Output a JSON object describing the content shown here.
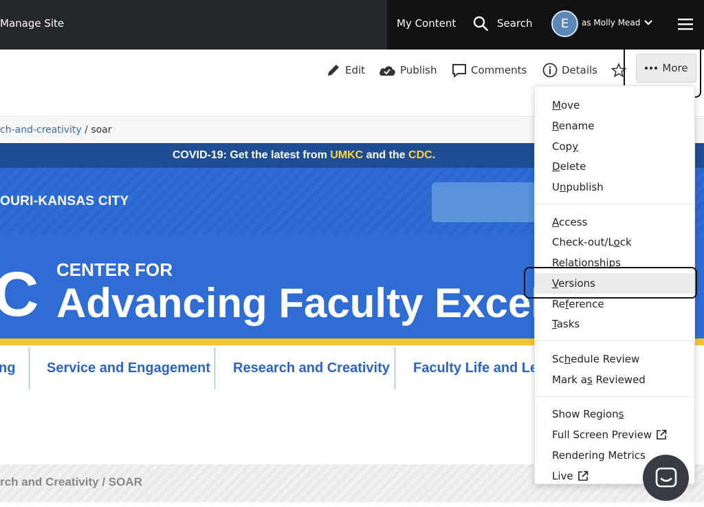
{
  "topbar": {
    "manage_site": "Manage Site",
    "my_content": "My Content",
    "search": "Search",
    "avatar_letter": "E",
    "as_user": "as Molly Mead"
  },
  "toolbar": {
    "edit": "Edit",
    "publish": "Publish",
    "comments": "Comments",
    "details": "Details",
    "more": "More"
  },
  "breadcrumb": {
    "parent": "ch-and-creativity",
    "separator": "/",
    "current": "soar"
  },
  "banner": {
    "prefix": "COVID-19: Get the latest from ",
    "umkc": "UMKC",
    "middle": " and the ",
    "cdc": "CDC",
    "suffix": "."
  },
  "hero": {
    "university": "OURI-KANSAS CITY",
    "logo_letter": "C",
    "center_for": "CENTER FOR",
    "title": "Advancing Faculty Excelle"
  },
  "nav": [
    "ng",
    "Service and Engagement",
    "Research and Creativity",
    "Faculty Life and Lea"
  ],
  "lower_breadcrumb": "rch and Creativity / SOAR",
  "menu": {
    "group1": [
      {
        "pre": "",
        "u": "M",
        "post": "ove"
      },
      {
        "pre": "",
        "u": "R",
        "post": "ename"
      },
      {
        "pre": "Cop",
        "u": "y",
        "post": ""
      },
      {
        "pre": "",
        "u": "D",
        "post": "elete"
      },
      {
        "pre": "U",
        "u": "n",
        "post": "publish"
      }
    ],
    "group2": [
      {
        "pre": "",
        "u": "A",
        "post": "ccess"
      },
      {
        "pre": "Check-out/L",
        "u": "o",
        "post": "ck"
      },
      {
        "pre": "Relat",
        "u": "i",
        "post": "onships"
      },
      {
        "pre": "",
        "u": "V",
        "post": "ersions"
      },
      {
        "pre": "Re",
        "u": "f",
        "post": "erence"
      },
      {
        "pre": "",
        "u": "T",
        "post": "asks"
      }
    ],
    "group3": [
      {
        "pre": "Sc",
        "u": "h",
        "post": "edule Review"
      },
      {
        "pre": "Mark a",
        "u": "s",
        "post": " Reviewed"
      }
    ],
    "group4": [
      {
        "pre": "Show Region",
        "u": "s",
        "post": ""
      },
      {
        "pre": "Full Screen Preview",
        "u": "",
        "post": ""
      },
      {
        "pre": "Rendering Metrics",
        "u": "",
        "post": ""
      },
      {
        "pre": "Live",
        "u": "",
        "post": ""
      }
    ]
  },
  "colors": {
    "topbar": "#24272b",
    "hero_blue": "#2f6dd4",
    "banner_blue": "#1f4d93",
    "accent_yellow": "#ffd23f",
    "nav_text": "#2a63c4"
  }
}
